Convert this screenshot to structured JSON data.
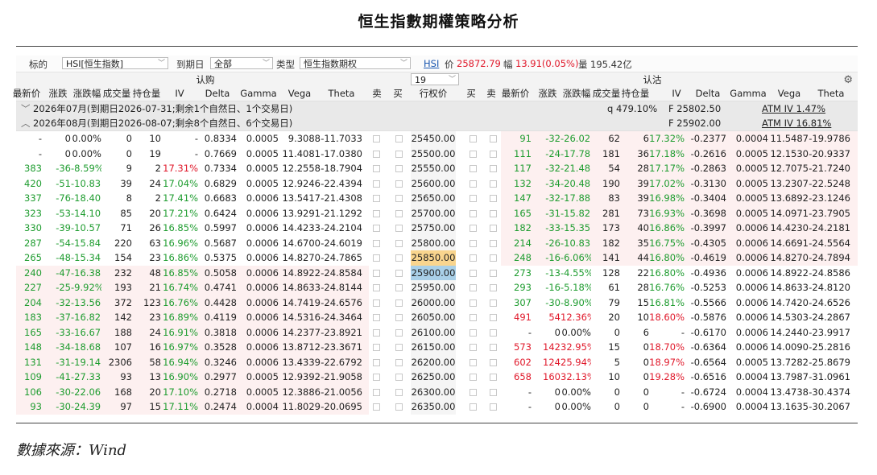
{
  "page_title": "恒生指數期權策略分析",
  "source": "數據來源：Wind",
  "toolbar": {
    "label_target": "标的",
    "target_value": "HSI[恒生指数]",
    "label_expiry": "到期日",
    "expiry_value": "全部",
    "label_type": "类型",
    "type_value": "恒生指数期权",
    "hsi_link": "HSI",
    "price_label": "价",
    "price_value": "25872.79",
    "change_label": "幅",
    "change_value": "13.91(0.05%)",
    "volume_label": "量",
    "volume_value": "195.42亿"
  },
  "header": {
    "call_label": "认购",
    "put_label": "认沽",
    "strike_count": "19",
    "call_cols": [
      "最新价",
      "涨跌",
      "涨跌幅",
      "成交量",
      "持仓量",
      "IV",
      "Delta",
      "Gamma",
      "Vega",
      "Theta",
      "卖",
      "买"
    ],
    "strike_col": "行权价",
    "put_cols": [
      "买",
      "卖",
      "最新价",
      "涨跌",
      "涨跌幅",
      "成交量",
      "持仓量",
      "IV",
      "Delta",
      "Gamma",
      "Vega",
      "Theta"
    ]
  },
  "groups": [
    {
      "text": "2026年07月(到期日2026-07-31;剩余1个自然日、1个交易日)",
      "q": "q  479.10%",
      "f": "F  25802.50",
      "atm": "ATM IV 1.47%",
      "expanded": false
    },
    {
      "text": "2026年08月(到期日2026-08-07;剩余8个自然日、6个交易日)",
      "q": "",
      "f": "F  25902.00",
      "atm": "ATM IV 16.81%",
      "expanded": true
    }
  ],
  "rows": [
    {
      "c": [
        "-",
        "0",
        "0.00%",
        "0",
        "10",
        "-",
        "0.8334",
        "0.0005",
        "9.3088",
        "-11.7033"
      ],
      "k": "25450.00",
      "p": [
        "91",
        "-32",
        "-26.02'",
        "62",
        "6",
        "17.32%",
        "-0.2377",
        "0.0004",
        "11.5487",
        "-19.9786"
      ],
      "cs": "n",
      "ps": "g",
      "sh": "p",
      "hl": ""
    },
    {
      "c": [
        "-",
        "0",
        "0.00%",
        "0",
        "19",
        "-",
        "0.7669",
        "0.0005",
        "11.4081",
        "-17.0380"
      ],
      "k": "25500.00",
      "p": [
        "111",
        "-24",
        "-17.78'",
        "181",
        "36",
        "17.18%",
        "-0.2616",
        "0.0005",
        "12.1530",
        "-20.9337"
      ],
      "cs": "n",
      "ps": "g",
      "sh": "p",
      "hl": ""
    },
    {
      "c": [
        "383",
        "-36",
        "-8.59%",
        "9",
        "2",
        "17.31%",
        "0.7334",
        "0.0005",
        "12.2558",
        "-18.7904"
      ],
      "k": "25550.00",
      "p": [
        "117",
        "-32",
        "-21.48'",
        "54",
        "28",
        "17.17%",
        "-0.2863",
        "0.0005",
        "12.7075",
        "-21.7240"
      ],
      "cs": "g",
      "ivs": "r",
      "ps": "g",
      "sh": "p",
      "hl": ""
    },
    {
      "c": [
        "420",
        "-51",
        "-10.83'",
        "39",
        "24",
        "17.04%",
        "0.6829",
        "0.0005",
        "12.9246",
        "-22.4394"
      ],
      "k": "25600.00",
      "p": [
        "132",
        "-34",
        "-20.48'",
        "190",
        "39",
        "17.02%",
        "-0.3130",
        "0.0005",
        "13.2307",
        "-22.5248"
      ],
      "cs": "g",
      "ps": "g",
      "sh": "p",
      "hl": ""
    },
    {
      "c": [
        "337",
        "-76",
        "-18.40'",
        "8",
        "2",
        "17.41%",
        "0.6683",
        "0.0006",
        "13.5417",
        "-21.4308"
      ],
      "k": "25650.00",
      "p": [
        "147",
        "-32",
        "-17.88'",
        "83",
        "39",
        "16.98%",
        "-0.3404",
        "0.0005",
        "13.6892",
        "-23.1246"
      ],
      "cs": "g",
      "ps": "g",
      "sh": "p",
      "hl": ""
    },
    {
      "c": [
        "323",
        "-53",
        "-14.10'",
        "85",
        "20",
        "17.21%",
        "0.6424",
        "0.0006",
        "13.9291",
        "-21.1292"
      ],
      "k": "25700.00",
      "p": [
        "165",
        "-31",
        "-15.82'",
        "281",
        "73",
        "16.93%",
        "-0.3698",
        "0.0005",
        "14.0971",
        "-23.7905"
      ],
      "cs": "g",
      "ps": "g",
      "sh": "p",
      "hl": ""
    },
    {
      "c": [
        "330",
        "-39",
        "-10.57'",
        "71",
        "26",
        "16.85%",
        "0.5997",
        "0.0006",
        "14.4233",
        "-24.2104"
      ],
      "k": "25750.00",
      "p": [
        "182",
        "-33",
        "-15.35'",
        "173",
        "40",
        "16.86%",
        "-0.3997",
        "0.0006",
        "14.4230",
        "-24.2181"
      ],
      "cs": "g",
      "ps": "g",
      "sh": "p",
      "hl": ""
    },
    {
      "c": [
        "287",
        "-54",
        "-15.84'",
        "220",
        "63",
        "16.96%",
        "0.5687",
        "0.0006",
        "14.6700",
        "-24.6019"
      ],
      "k": "25800.00",
      "p": [
        "214",
        "-26",
        "-10.83'",
        "182",
        "35",
        "16.75%",
        "-0.4305",
        "0.0006",
        "14.6691",
        "-24.5564"
      ],
      "cs": "g",
      "ps": "g",
      "sh": "p",
      "hl": ""
    },
    {
      "c": [
        "265",
        "-48",
        "-15.34'",
        "154",
        "23",
        "16.86%",
        "0.5375",
        "0.0006",
        "14.8270",
        "-24.7865"
      ],
      "k": "25850.00",
      "p": [
        "248",
        "-16",
        "-6.06%",
        "141",
        "44",
        "16.80%",
        "-0.4619",
        "0.0006",
        "14.8270",
        "-24.7894"
      ],
      "cs": "g",
      "ps": "g",
      "sh": "p",
      "hl": "o"
    },
    {
      "c": [
        "240",
        "-47",
        "-16.38'",
        "232",
        "48",
        "16.85%",
        "0.5058",
        "0.0006",
        "14.8922",
        "-24.8584"
      ],
      "k": "25900.00",
      "p": [
        "273",
        "-13",
        "-4.55%",
        "128",
        "22",
        "16.80%",
        "-0.4936",
        "0.0006",
        "14.8922",
        "-24.8586"
      ],
      "cs": "g",
      "ps": "g",
      "sh": "c",
      "hl": "b"
    },
    {
      "c": [
        "227",
        "-25",
        "-9.92%",
        "193",
        "21",
        "16.74%",
        "0.4741",
        "0.0006",
        "14.8633",
        "-24.8144"
      ],
      "k": "25950.00",
      "p": [
        "293",
        "-16",
        "-5.18%",
        "61",
        "28",
        "16.76%",
        "-0.5253",
        "0.0006",
        "14.8633",
        "-24.8120"
      ],
      "cs": "g",
      "ps": "g",
      "sh": "c",
      "hl": ""
    },
    {
      "c": [
        "204",
        "-32",
        "-13.56'",
        "372",
        "123",
        "16.76%",
        "0.4428",
        "0.0006",
        "14.7419",
        "-24.6576"
      ],
      "k": "26000.00",
      "p": [
        "307",
        "-30",
        "-8.90%",
        "79",
        "15",
        "16.81%",
        "-0.5566",
        "0.0006",
        "14.7420",
        "-24.6526"
      ],
      "cs": "g",
      "ps": "g",
      "sh": "c",
      "hl": ""
    },
    {
      "c": [
        "183",
        "-37",
        "-16.82'",
        "142",
        "23",
        "16.89%",
        "0.4119",
        "0.0006",
        "14.5316",
        "-24.3464"
      ],
      "k": "26050.00",
      "p": [
        "491",
        "54",
        "12.36%",
        "20",
        "10",
        "18.60%",
        "-0.5876",
        "0.0006",
        "14.5303",
        "-24.2867"
      ],
      "cs": "g",
      "ps": "r",
      "sh": "c",
      "hl": ""
    },
    {
      "c": [
        "165",
        "-33",
        "-16.67'",
        "188",
        "24",
        "16.91%",
        "0.3818",
        "0.0006",
        "14.2377",
        "-23.8921"
      ],
      "k": "26100.00",
      "p": [
        "-",
        "0",
        "0.00%",
        "0",
        "6",
        "-",
        "-0.6170",
        "0.0006",
        "14.2440",
        "-23.9917"
      ],
      "cs": "g",
      "ps": "n",
      "sh": "c",
      "hl": ""
    },
    {
      "c": [
        "148",
        "-34",
        "-18.68'",
        "107",
        "16",
        "16.97%",
        "0.3528",
        "0.0006",
        "13.8712",
        "-23.3671"
      ],
      "k": "26150.00",
      "p": [
        "573",
        "142",
        "32.95%",
        "15",
        "0",
        "18.70%",
        "-0.6364",
        "0.0006",
        "14.0090",
        "-25.2816"
      ],
      "cs": "g",
      "ps": "r",
      "sh": "c",
      "hl": ""
    },
    {
      "c": [
        "131",
        "-31",
        "-19.14'",
        "2306",
        "58",
        "16.94%",
        "0.3246",
        "0.0006",
        "13.4339",
        "-22.6792"
      ],
      "k": "26200.00",
      "p": [
        "602",
        "124",
        "25.94%",
        "5",
        "0",
        "18.97%",
        "-0.6564",
        "0.0005",
        "13.7282",
        "-25.8679"
      ],
      "cs": "g",
      "ps": "r",
      "sh": "c",
      "hl": ""
    },
    {
      "c": [
        "109",
        "-41",
        "-27.33'",
        "93",
        "13",
        "16.90%",
        "0.2977",
        "0.0005",
        "12.9392",
        "-21.9058"
      ],
      "k": "26250.00",
      "p": [
        "658",
        "160",
        "32.13%",
        "10",
        "0",
        "19.28%",
        "-0.6516",
        "0.0004",
        "13.7987",
        "-31.0961"
      ],
      "cs": "g",
      "ps": "r",
      "sh": "c",
      "hl": ""
    },
    {
      "c": [
        "106",
        "-30",
        "-22.06'",
        "168",
        "20",
        "17.10%",
        "0.2718",
        "0.0005",
        "12.3886",
        "-21.0056"
      ],
      "k": "26300.00",
      "p": [
        "-",
        "0",
        "0.00%",
        "0",
        "0",
        "-",
        "-0.6724",
        "0.0004",
        "13.4738",
        "-30.4374"
      ],
      "cs": "g",
      "ps": "n",
      "sh": "c",
      "hl": ""
    },
    {
      "c": [
        "93",
        "-30",
        "-24.39'",
        "97",
        "15",
        "17.11%",
        "0.2474",
        "0.0004",
        "11.8029",
        "-20.0695"
      ],
      "k": "26350.00",
      "p": [
        "-",
        "0",
        "0.00%",
        "0",
        "0",
        "-",
        "-0.6900",
        "0.0004",
        "13.1635",
        "-30.2067"
      ],
      "cs": "g",
      "ps": "n",
      "sh": "c",
      "hl": ""
    }
  ],
  "colors": {
    "up": "#e0182a",
    "down": "#1e9c2f",
    "itm_shade": "#fdf0f0",
    "atm_orange": "#f9d58e",
    "atm_blue": "#a9d0e8"
  },
  "icons": {
    "settings": "gear-icon",
    "dropdown": "chevron-down-icon"
  }
}
